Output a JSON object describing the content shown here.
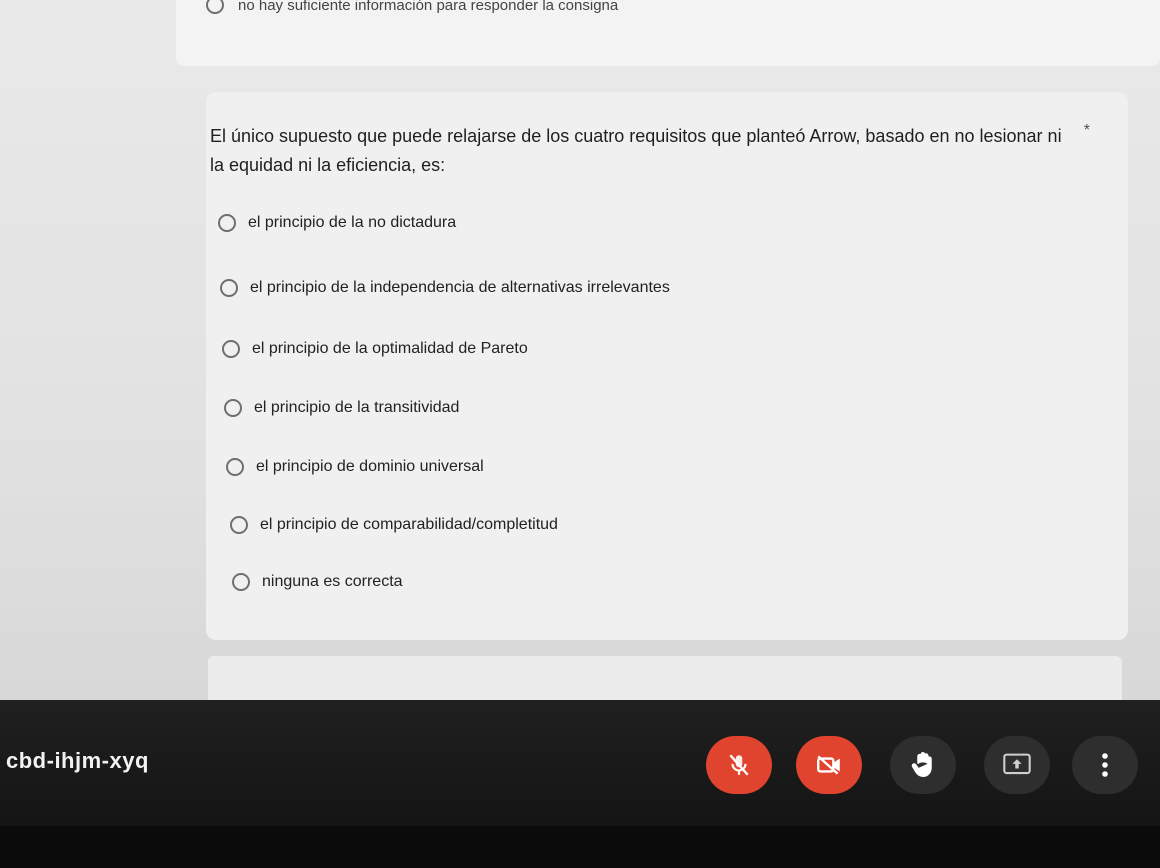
{
  "previous_question": {
    "last_option_label": "no hay suficiente información para responder la consigna"
  },
  "question": {
    "text": "El único supuesto que puede relajarse de los cuatro requisitos que planteó Arrow, basado en no lesionar ni la equidad ni la eficiencia, es:",
    "required_marker": "*",
    "options": [
      {
        "label": "el principio de la no dictadura"
      },
      {
        "label": "el principio de la independencia de alternativas irrelevantes"
      },
      {
        "label": "el principio de la optimalidad de Pareto"
      },
      {
        "label": "el principio de la transitividad"
      },
      {
        "label": "el principio de dominio universal"
      },
      {
        "label": "el principio de comparabilidad/completitud"
      },
      {
        "label": "ninguna es correcta"
      }
    ]
  },
  "meet": {
    "meeting_code": "cbd-ihjm-xyq",
    "controls": [
      {
        "icon": "microphone-off-icon",
        "state": "off",
        "color": "#e0442f"
      },
      {
        "icon": "camera-off-icon",
        "state": "off",
        "color": "#e0442f"
      },
      {
        "icon": "raise-hand-icon",
        "color": "#2e2e2e"
      },
      {
        "icon": "present-screen-icon",
        "color": "#2e2e2e"
      },
      {
        "icon": "more-options-icon",
        "color": "#2e2e2e"
      }
    ]
  }
}
